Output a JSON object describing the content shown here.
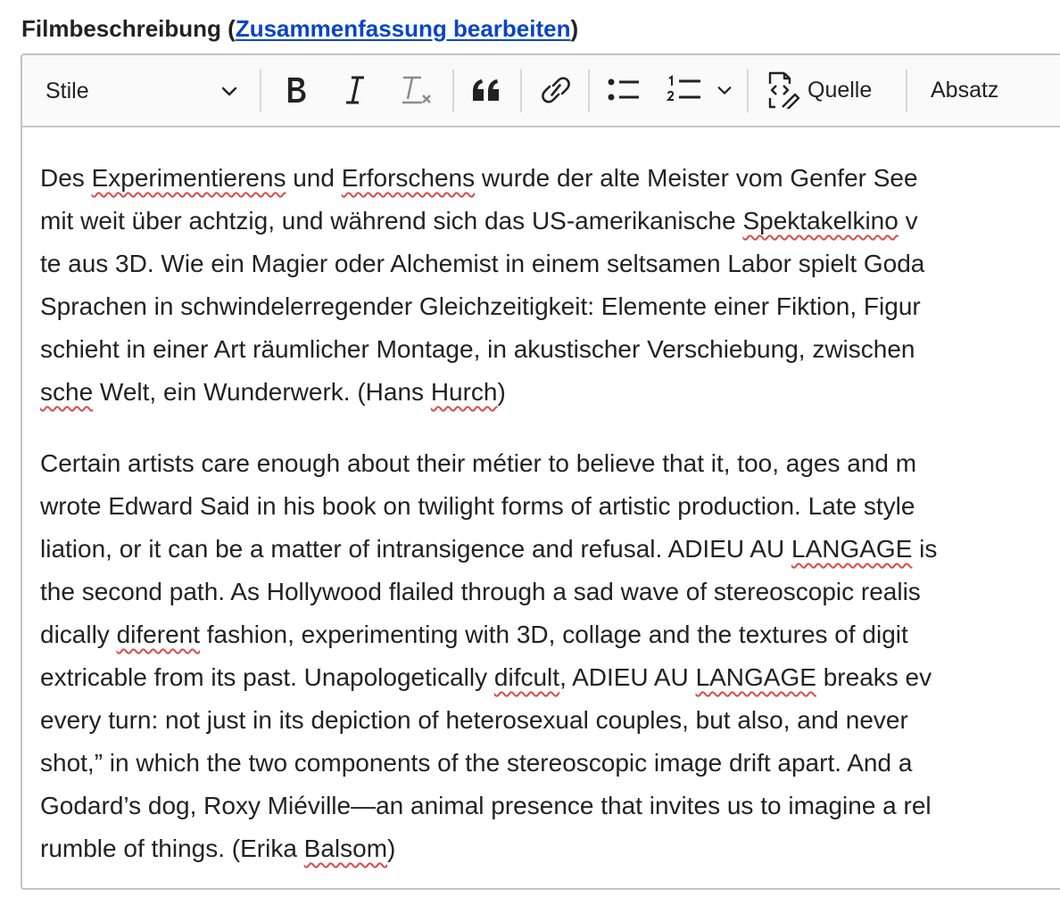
{
  "field": {
    "label": "Filmbeschreibung",
    "paren_open": "(",
    "link": "Zusammenfassung bearbeiten",
    "paren_close": ")"
  },
  "toolbar": {
    "styles_label": "Stile",
    "source_label": "Quelle",
    "paragraph_label": "Absatz"
  },
  "content": {
    "paragraph1": {
      "lines": [
        [
          "Des ",
          {
            "t": "Experimentierens",
            "sp": true
          },
          " und ",
          {
            "t": "Erforschens",
            "sp": true
          },
          " wurde der alte Meister vom Genfer See"
        ],
        [
          "mit weit über achtzig, und während sich das US-amerikanische ",
          {
            "t": "Spektakelkino",
            "sp": true
          },
          " v"
        ],
        [
          "te aus 3D. Wie ein Magier oder Alchemist in einem seltsamen Labor spielt Goda"
        ],
        [
          "Sprachen in schwindelerregender Gleichzeitigkeit: Elemente einer Fiktion, Figur"
        ],
        [
          "schieht in einer Art räumlicher Montage, in akustischer Verschiebung, zwischen"
        ],
        [
          {
            "t": "sche",
            "sp": true
          },
          " Welt, ein Wunderwerk. (Hans ",
          {
            "t": "Hurch",
            "sp": true
          },
          ")"
        ]
      ]
    },
    "paragraph2": {
      "lines": [
        [
          "Certain artists care enough about their métier to believe that it, too, ages and m"
        ],
        [
          "wrote Edward Said in his book on twilight forms of artistic production. Late style"
        ],
        [
          "liation, or it can be a matter of intransigence and refusal. ADIEU AU ",
          {
            "t": "LANGAGE",
            "sp": true
          },
          " is"
        ],
        [
          "the second path. As Hollywood flailed through a sad wave of stereoscopic realis"
        ],
        [
          "dically ",
          {
            "t": "diferent",
            "sp": true
          },
          " fashion, experimenting with 3D, collage and the textures of digit"
        ],
        [
          "extricable from its past. Unapologetically ",
          {
            "t": "difcult",
            "sp": true
          },
          ", ADIEU AU ",
          {
            "t": "LANGAGE",
            "sp": true
          },
          " breaks ev"
        ],
        [
          "every turn: not just in its depiction of heterosexual couples, but also, and never"
        ],
        [
          "shot,” in which the two components of the stereoscopic image drift apart. And a"
        ],
        [
          "Godard’s dog, Roxy Miéville—an animal presence that invites us to imagine a rel"
        ],
        [
          "rumble of things. (Erika ",
          {
            "t": "Balsom",
            "sp": true
          },
          ")"
        ]
      ]
    }
  },
  "colors": {
    "link": "#0645c8",
    "spellcheck": "#d94b4b",
    "border": "#c3c3c3"
  }
}
